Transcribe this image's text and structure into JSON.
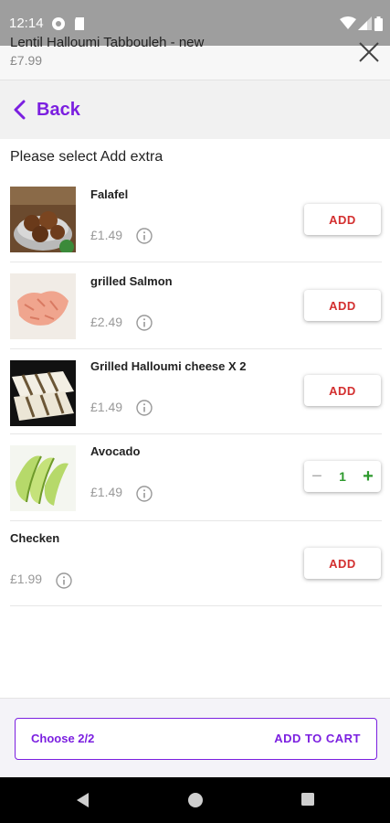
{
  "status_bar": {
    "time": "12:14"
  },
  "header": {
    "title": "Lentil Halloumi Tabbouleh - new",
    "price": "£7.99"
  },
  "nav": {
    "back_label": "Back"
  },
  "section": {
    "heading": "Please select Add extra"
  },
  "extras": [
    {
      "name": "Falafel",
      "price": "£1.49",
      "action": "ADD"
    },
    {
      "name": "grilled Salmon",
      "price": "£2.49",
      "action": "ADD"
    },
    {
      "name": "Grilled Halloumi cheese X 2",
      "price": "£1.49",
      "action": "ADD"
    },
    {
      "name": "Avocado",
      "price": "£1.49",
      "quantity": "1"
    },
    {
      "name": "Checken",
      "price": "£1.99",
      "action": "ADD"
    }
  ],
  "footer": {
    "choose_label": "Choose 2/2",
    "add_to_cart_label": "ADD TO CART"
  },
  "colors": {
    "accent": "#7b1fe0",
    "add_red": "#d32f2f",
    "qty_green": "#2e9a2e"
  },
  "icons": {
    "status": [
      "pocket-casts-icon",
      "sd-card-icon",
      "wifi-icon",
      "signal-icon",
      "battery-icon"
    ],
    "header": "close-icon",
    "back": "chevron-left-icon",
    "info": "info-icon",
    "system_nav": [
      "nav-back-icon",
      "nav-home-icon",
      "nav-recents-icon"
    ]
  }
}
